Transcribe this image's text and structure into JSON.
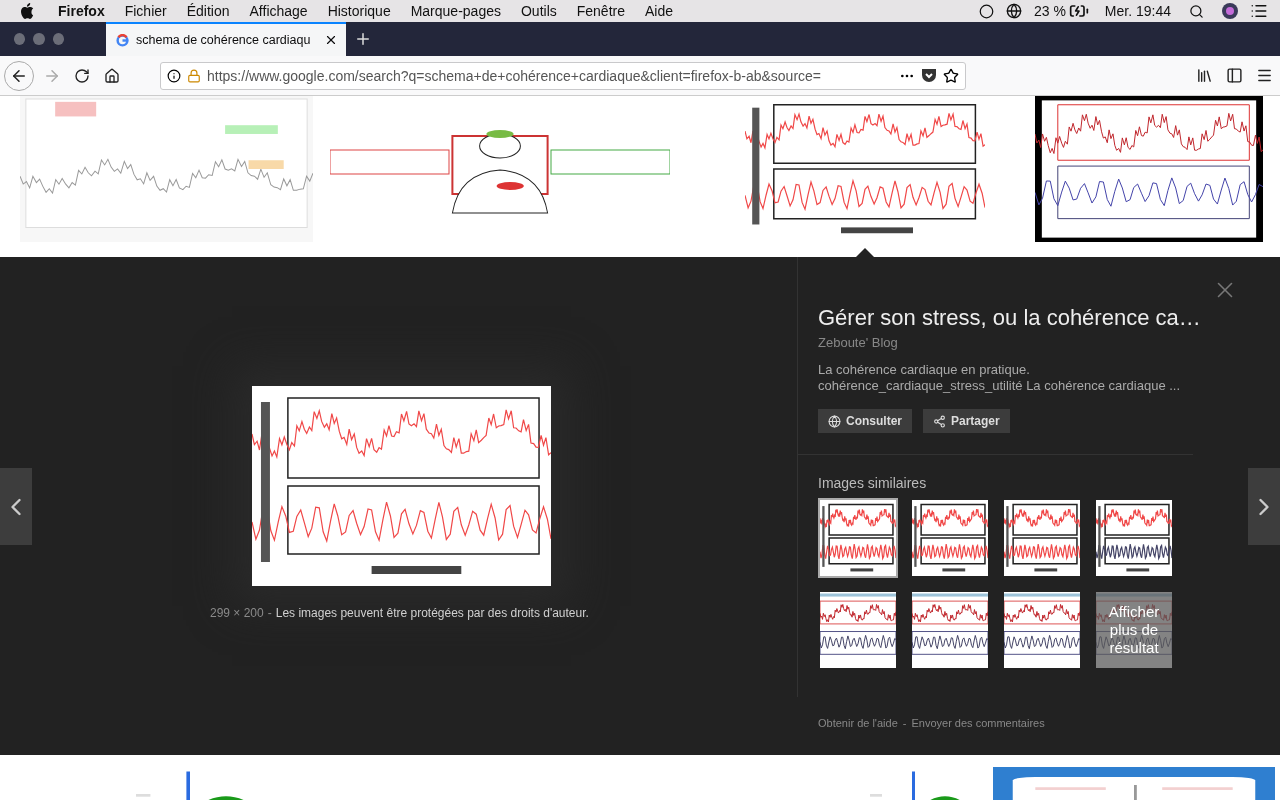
{
  "menu_bar": {
    "app": "Firefox",
    "menus": [
      "Fichier",
      "Édition",
      "Affichage",
      "Historique",
      "Marque-pages",
      "Outils",
      "Fenêtre",
      "Aide"
    ],
    "battery": "23 %",
    "clock": "Mer. 19:44"
  },
  "tab_bar": {
    "tabs": [
      {
        "title": "schema de cohérence cardiaqu",
        "selected": true
      }
    ]
  },
  "nav_bar": {
    "url": "https://www.google.com/search?q=schema+de+cohérence+cardiaque&client=firefox-b-ab&source="
  },
  "top_results": [
    {
      "kind": "picture",
      "selected": false
    },
    {
      "kind": "picture",
      "selected": false
    },
    {
      "kind": "picture",
      "selected": true
    },
    {
      "kind": "picture",
      "selected": false
    }
  ],
  "viewer": {
    "dimensions": "299 × 200",
    "separator": "-",
    "notice": "Les images peuvent être protégées par des droits d'auteur.",
    "title": "Gérer son stress, ou la cohérence ca…",
    "source": "Zeboute' Blog",
    "description": [
      "La cohérence cardiaque en pratique.",
      "cohérence_cardiaque_stress_utilité La cohérence cardiaque ..."
    ],
    "buttons": [
      {
        "kind": "visit",
        "label": "Consulter"
      },
      {
        "kind": "share",
        "label": "Partager"
      }
    ],
    "similar_heading": "Images similaires",
    "similar": [
      {
        "selected": true
      },
      {
        "selected": false
      },
      {
        "selected": false
      },
      {
        "selected": false
      },
      {
        "selected": false
      },
      {
        "selected": false
      },
      {
        "selected": false
      },
      {
        "selected": false,
        "overlay": "Afficher plus de résultat"
      }
    ],
    "footer_links": [
      "Obtenir de l'aide",
      "Envoyer des commentaires"
    ],
    "footer_separator": "-"
  },
  "bottom_results": [
    {
      "kind": "picture"
    },
    {
      "kind": "picture"
    },
    {
      "kind": "picture"
    }
  ]
}
